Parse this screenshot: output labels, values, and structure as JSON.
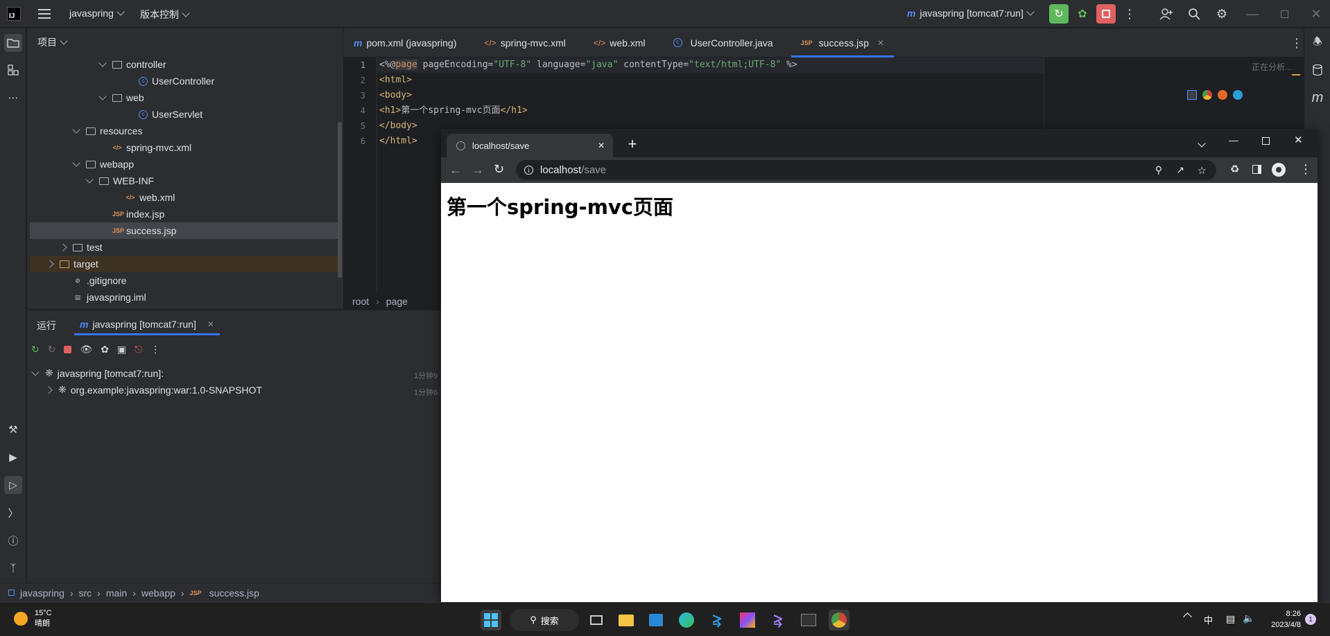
{
  "titlebar": {
    "logo": "IJ",
    "menu_icon": "hamburger-icon",
    "project": "javaspring",
    "vcs": "版本控制",
    "run_config": "javaspring [tomcat7:run]"
  },
  "project_panel": {
    "title": "项目",
    "tree": [
      {
        "label": "controller",
        "icon": "folder",
        "indent": 5,
        "twisty": "open"
      },
      {
        "label": "UserController",
        "icon": "class",
        "indent": 7,
        "twisty": "none"
      },
      {
        "label": "web",
        "icon": "folder",
        "indent": 5,
        "twisty": "open"
      },
      {
        "label": "UserServlet",
        "icon": "class",
        "indent": 7,
        "twisty": "none"
      },
      {
        "label": "resources",
        "icon": "folder",
        "indent": 3,
        "twisty": "open"
      },
      {
        "label": "spring-mvc.xml",
        "icon": "xml",
        "indent": 5,
        "twisty": "none"
      },
      {
        "label": "webapp",
        "icon": "folder",
        "indent": 3,
        "twisty": "open"
      },
      {
        "label": "WEB-INF",
        "icon": "folder",
        "indent": 4,
        "twisty": "open"
      },
      {
        "label": "web.xml",
        "icon": "xml",
        "indent": 6,
        "twisty": "none"
      },
      {
        "label": "index.jsp",
        "icon": "jsp",
        "indent": 5,
        "twisty": "none"
      },
      {
        "label": "success.jsp",
        "icon": "jsp",
        "indent": 5,
        "twisty": "none",
        "selected": true
      },
      {
        "label": "test",
        "icon": "folder",
        "indent": 2,
        "twisty": "closed"
      },
      {
        "label": "target",
        "icon": "folder-yellow",
        "indent": 1,
        "twisty": "closed",
        "highlight": true
      },
      {
        "label": ".gitignore",
        "icon": "gitignore",
        "indent": 2,
        "twisty": "none"
      },
      {
        "label": "javaspring.iml",
        "icon": "iml",
        "indent": 2,
        "twisty": "none"
      }
    ]
  },
  "editor": {
    "tabs": [
      {
        "label": "pom.xml (javaspring)",
        "icon": "m"
      },
      {
        "label": "spring-mvc.xml",
        "icon": "xml"
      },
      {
        "label": "web.xml",
        "icon": "xml"
      },
      {
        "label": "UserController.java",
        "icon": "class"
      },
      {
        "label": "success.jsp",
        "icon": "jsp",
        "active": true
      }
    ],
    "line_numbers": [
      "1",
      "2",
      "3",
      "4",
      "5",
      "6"
    ],
    "code": {
      "l1_a": "<%@",
      "l1_b": "page",
      "l1_c": " pageEncoding=",
      "l1_d": "\"UTF-8\"",
      "l1_e": " language=",
      "l1_f": "\"java\"",
      "l1_g": " contentType=",
      "l1_h": "\"text/html;UTF-8\"",
      "l1_i": " %>",
      "l2": "<html>",
      "l3": "<body>",
      "l4_a": "<h1>",
      "l4_b": "第一个spring-mvc页面",
      "l4_c": "</h1>",
      "l5": "</body>",
      "l6": "</html>"
    },
    "analyzing": "正在分析...",
    "breadcrumb": [
      "root",
      "page"
    ]
  },
  "run_panel": {
    "label": "运行",
    "tab": "javaspring [tomcat7:run]",
    "items": [
      {
        "label": "javaspring [tomcat7:run]:",
        "time": "1分钟9"
      },
      {
        "label": "org.example:javaspring:war:1.0-SNAPSHOT",
        "time": "1分钟6"
      }
    ]
  },
  "browser": {
    "tab_title": "localhost/save",
    "url_host": "localhost",
    "url_path": "/save",
    "heading": "第一个spring-mvc页面"
  },
  "statusbar": {
    "path": [
      "javaspring",
      "src",
      "main",
      "webapp",
      "success.jsp"
    ]
  },
  "taskbar": {
    "weather_temp": "15°C",
    "weather_desc": "晴朗",
    "search": "搜索",
    "ime": "中",
    "time": "8:26",
    "date": "2023/4/8",
    "notif": "1"
  },
  "colors": {
    "accent": "#3574f0",
    "run_green": "#5fb85b",
    "stop_red": "#e06060"
  }
}
